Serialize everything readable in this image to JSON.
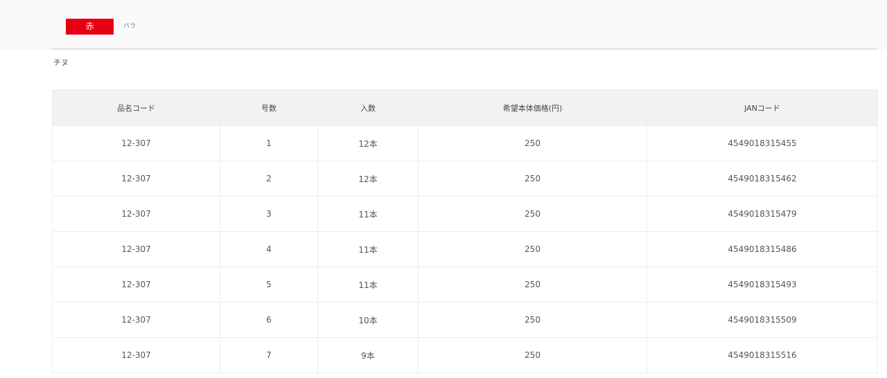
{
  "tag": {
    "label": "赤",
    "sublabel": "バラ",
    "color": "#e60012"
  },
  "note": "チヌ",
  "table": {
    "headers": [
      "品名コード",
      "号数",
      "入数",
      "希望本体価格(円)",
      "JANコード"
    ],
    "rows": [
      [
        "12-307",
        "1",
        "12本",
        "250",
        "4549018315455"
      ],
      [
        "12-307",
        "2",
        "12本",
        "250",
        "4549018315462"
      ],
      [
        "12-307",
        "3",
        "11本",
        "250",
        "4549018315479"
      ],
      [
        "12-307",
        "4",
        "11本",
        "250",
        "4549018315486"
      ],
      [
        "12-307",
        "5",
        "11本",
        "250",
        "4549018315493"
      ],
      [
        "12-307",
        "6",
        "10本",
        "250",
        "4549018315509"
      ],
      [
        "12-307",
        "7",
        "9本",
        "250",
        "4549018315516"
      ]
    ]
  }
}
